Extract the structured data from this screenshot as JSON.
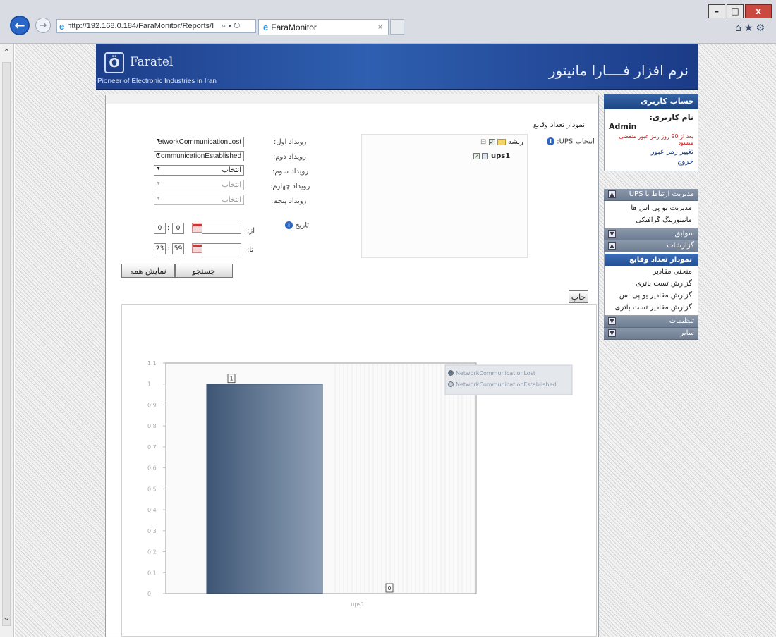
{
  "browser": {
    "address": "http://192.168.0.184/FaraMonitor/Reports/I",
    "address_tools": "⌕ ▾ ↻",
    "tab_title": "FaraMonitor",
    "tab_close": "×",
    "win_min": "–",
    "win_max": "□",
    "win_close": "x",
    "tool_icons": "⌂★⚙",
    "back_icon": "←",
    "fwd_icon": "→"
  },
  "header": {
    "logo_mark": "Ö",
    "logo_name": "Faratel",
    "logo_tagline": "Pioneer of Electronic Industries in Iran",
    "app_title": "نرم افزار فــــارا مانیتور"
  },
  "account": {
    "header": "حساب کاربری",
    "username_label": "نام کاربری:",
    "username": "Admin",
    "warning": "بعد از 90 روز رمز عبور منقضی میشود",
    "change_password": "تغییر رمز عبور",
    "logout": "خروج"
  },
  "menu": {
    "ups_management": {
      "title": "مدیریت ارتباط با UPS",
      "items": [
        "مدیریت یو پی اس ها",
        "مانیتورینگ گرافیکی"
      ]
    },
    "history": {
      "title": "سوابق"
    },
    "reports": {
      "title": "گزارشات",
      "items": [
        "نمودار تعداد وقایع",
        "منحنی مقادیر",
        "گزارش تست باتری",
        "گزارش مقادیر یو پی اس",
        "گزارش مقادیر تست باتری"
      ],
      "active_index": 0
    },
    "settings": {
      "title": "تنظیمات"
    },
    "other": {
      "title": "سایر"
    },
    "toggle_icon": "▲",
    "toggle_icon_down": "▼"
  },
  "form": {
    "page_heading": "نمودار تعداد وقایع",
    "ups_select_label": "انتخاب UPS:",
    "tree_root": "ریشه",
    "tree_child": "ups1",
    "events": [
      {
        "label": "رویداد اول:",
        "value": "etworkCommunicationLost",
        "disabled": false
      },
      {
        "label": "رویداد دوم:",
        "value": "CommunicationEstablished",
        "disabled": false
      },
      {
        "label": "رویداد سوم:",
        "value": "انتخاب",
        "disabled": false
      },
      {
        "label": "رویداد چهارم:",
        "value": "انتخاب",
        "disabled": true
      },
      {
        "label": "رویداد پنجم:",
        "value": "انتخاب",
        "disabled": true
      }
    ],
    "date_label": "تاریخ",
    "from_label": "از:",
    "to_label": "تا:",
    "from_hour": "0",
    "from_minute": "0",
    "to_hour": "23",
    "to_minute": "59",
    "search_button": "جستجو",
    "show_all_button": "نمایش همه",
    "print_button": "چاپ",
    "info_icon": "i",
    "check_mark": "✓"
  },
  "chart_data": {
    "type": "bar",
    "categories": [
      "ups1"
    ],
    "series": [
      {
        "name": "NetworkCommunicationLost",
        "values": [
          1
        ],
        "color": "#5f7691"
      },
      {
        "name": "NetworkCommunicationEstablished",
        "values": [
          0
        ],
        "color": "#b9c5d3"
      }
    ],
    "yticks": [
      "1.1",
      "1",
      "0.9",
      "0.8",
      "0.7",
      "0.6",
      "0.5",
      "0.4",
      "0.3",
      "0.2",
      "0.1",
      "0"
    ],
    "ylim": [
      0,
      1.1
    ],
    "legend": "top-right",
    "grid": true
  }
}
